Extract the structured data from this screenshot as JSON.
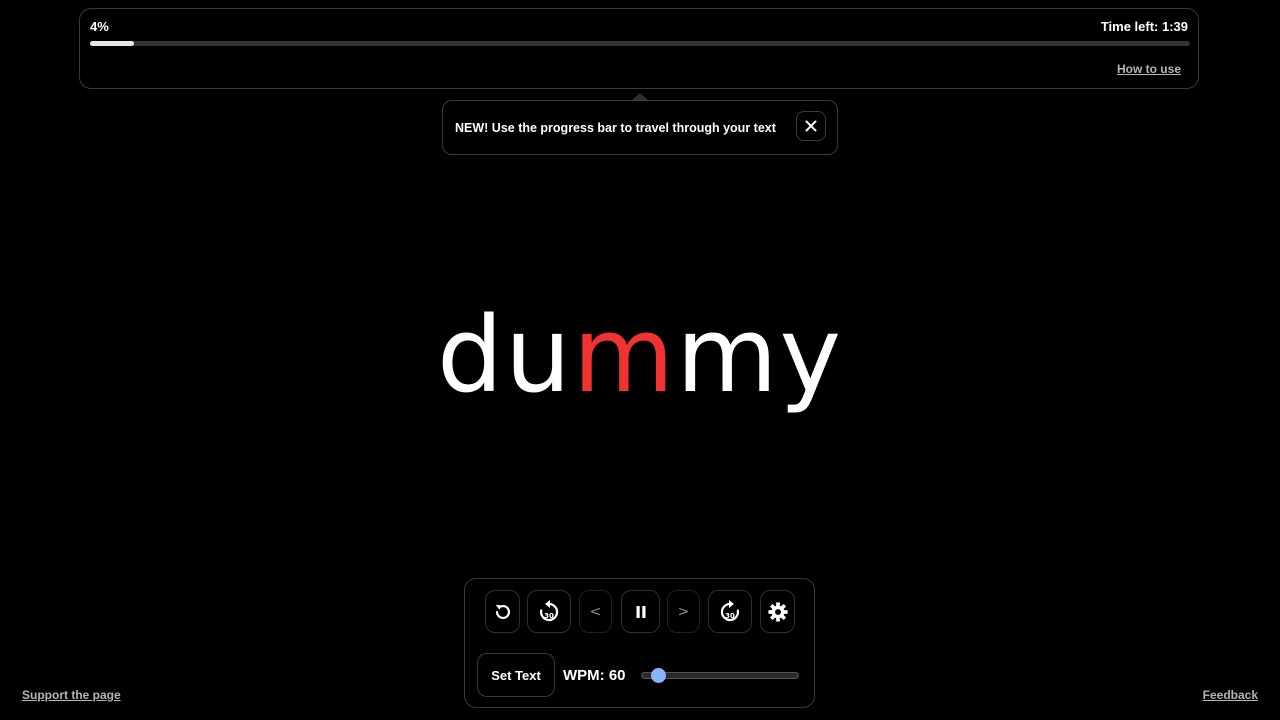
{
  "progress": {
    "percent_label": "4%",
    "fraction": 0.04,
    "time_left": "Time left: 1:39",
    "how_to_use": "How to use"
  },
  "tooltip": {
    "text": "NEW! Use the progress bar to travel through your text"
  },
  "reader": {
    "word_before": "du",
    "word_pivot": "m",
    "word_after": "my",
    "pivot_color": "#f03232"
  },
  "controls": {
    "prev_word": "<",
    "next_word": ">",
    "skip_seconds": "30",
    "set_text": "Set Text",
    "wpm_label": "WPM: 60",
    "wpm_slider_fraction": 0.06
  },
  "footer": {
    "support": "Support the page",
    "feedback": "Feedback"
  }
}
